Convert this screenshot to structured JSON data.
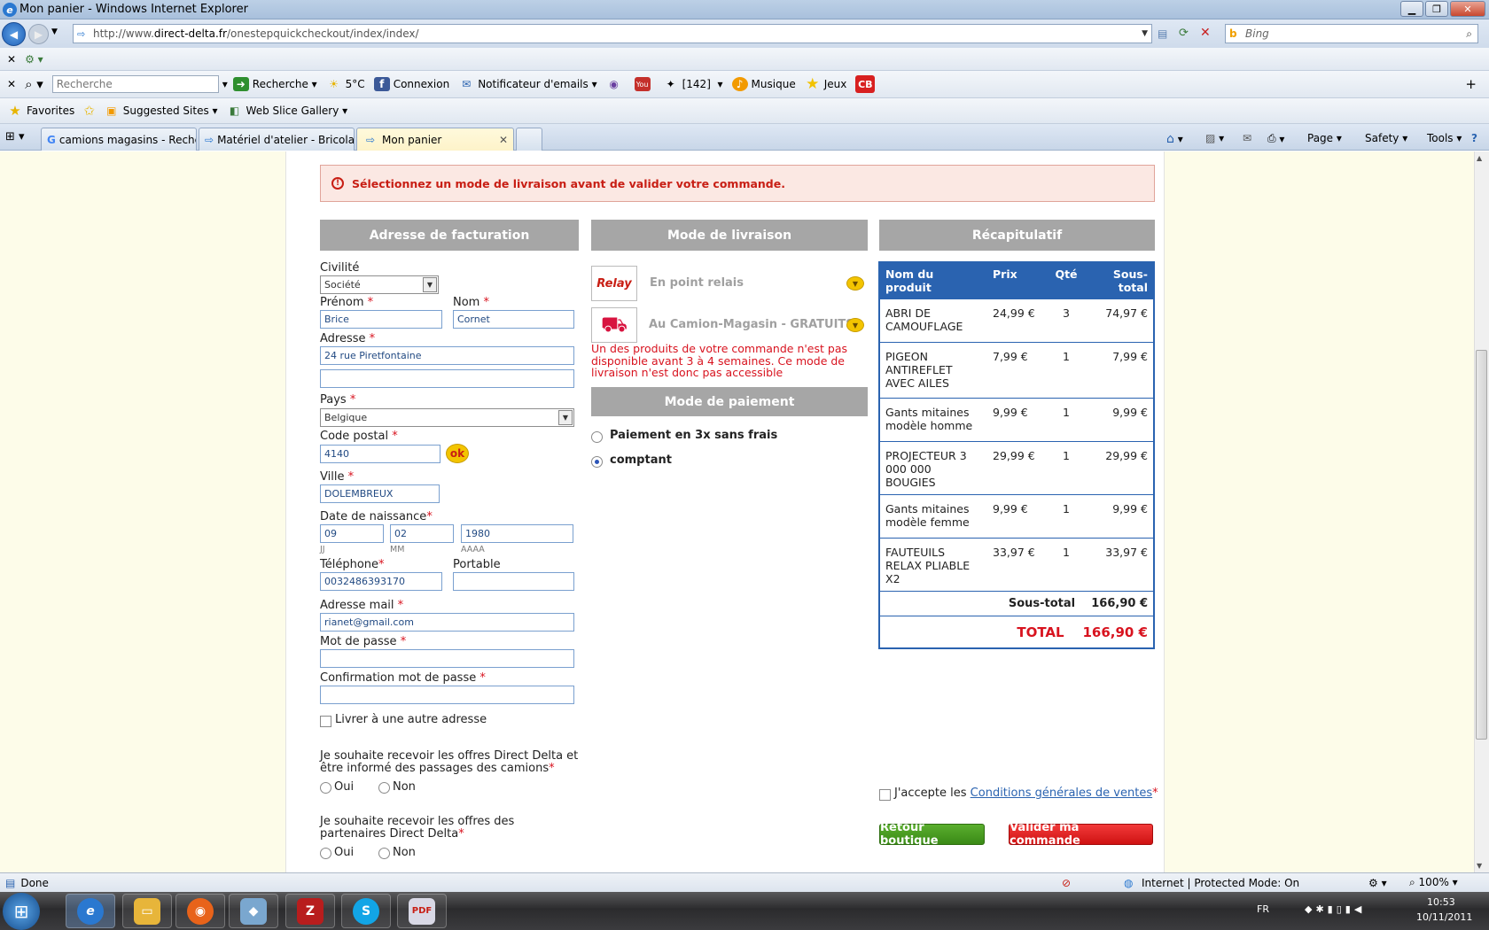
{
  "window": {
    "title": "Mon panier - Windows Internet Explorer"
  },
  "browser": {
    "url_prefix": "http://www.",
    "url_domain": "direct-delta.fr",
    "url_path": "/onestepquickcheckout/index/index/",
    "search_engine": "Bing"
  },
  "toolbar1": {
    "search_placeholder": "Recherche",
    "search_label": "Recherche",
    "weather": "5°C",
    "connexion": "Connexion",
    "mail_notifier": "Notificateur d'emails",
    "count": "[142]",
    "music": "Musique",
    "games": "Jeux",
    "cb": "CB"
  },
  "favbar": {
    "favorites": "Favorites",
    "suggested": "Suggested Sites",
    "webslice": "Web Slice Gallery"
  },
  "tabs": [
    {
      "label": "camions magasins - Reche..."
    },
    {
      "label": "Matériel d'atelier - Bricolage"
    },
    {
      "label": "Mon panier"
    }
  ],
  "commands": {
    "page": "Page",
    "safety": "Safety",
    "tools": "Tools"
  },
  "alert": "Sélectionnez un mode de livraison avant de valider votre commande.",
  "billing": {
    "header": "Adresse de facturation",
    "civilite_label": "Civilité",
    "civilite_value": "Société",
    "prenom_label": "Prénom",
    "prenom_value": "Brice",
    "nom_label": "Nom",
    "nom_value": "Cornet",
    "adresse_label": "Adresse",
    "adresse_value": "24 rue Piretfontaine",
    "pays_label": "Pays",
    "pays_value": "Belgique",
    "cp_label": "Code postal",
    "cp_value": "4140",
    "ok": "ok",
    "ville_label": "Ville",
    "ville_value": "DOLEMBREUX",
    "dob_label": "Date de naissance",
    "dob_day": "09",
    "dob_month": "02",
    "dob_year": "1980",
    "jj": "JJ",
    "mm": "MM",
    "aaaa": "AAAA",
    "tel_label": "Téléphone",
    "tel_value": "0032486393170",
    "portable_label": "Portable",
    "mail_label": "Adresse mail",
    "mail_value": "rianet@gmail.com",
    "pwd_label": "Mot de passe",
    "pwd_confirm_label": "Confirmation mot de passe",
    "other_address": "Livrer à une autre adresse",
    "offers_dd": "Je souhaite recevoir les offres Direct Delta et être informé des passages des camions",
    "offers_partners": "Je souhaite recevoir les offres des partenaires Direct Delta",
    "oui": "Oui",
    "non": "Non",
    "star": "*"
  },
  "shipping": {
    "header": "Mode de livraison",
    "relay": "En point relais",
    "relay_logo": "Relay",
    "truck": "Au Camion-Magasin - GRATUITS",
    "warning": "Un des produits de votre commande n'est pas disponible avant 3 à 4 semaines. Ce mode de livraison n'est donc pas accessible"
  },
  "payment": {
    "header": "Mode de paiement",
    "opt1": "Paiement en 3x sans frais",
    "opt2": "comptant"
  },
  "recap": {
    "header": "Récapitulatif",
    "col_name": "Nom du produit",
    "col_price": "Prix",
    "col_qty": "Qté",
    "col_sub": "Sous-total",
    "items": [
      {
        "name": "ABRI DE CAMOUFLAGE",
        "price": "24,99 €",
        "qty": "3",
        "sub": "74,97 €"
      },
      {
        "name": "PIGEON ANTIREFLET AVEC AILES",
        "price": "7,99 €",
        "qty": "1",
        "sub": "7,99 €"
      },
      {
        "name": "Gants mitaines modèle homme",
        "price": "9,99 €",
        "qty": "1",
        "sub": "9,99 €"
      },
      {
        "name": "PROJECTEUR 3 000 000 BOUGIES",
        "price": "29,99 €",
        "qty": "1",
        "sub": "29,99 €"
      },
      {
        "name": "Gants mitaines modèle femme",
        "price": "9,99 €",
        "qty": "1",
        "sub": "9,99 €"
      },
      {
        "name": "FAUTEUILS RELAX PLIABLE X2",
        "price": "33,97 €",
        "qty": "1",
        "sub": "33,97 €"
      }
    ],
    "subtotal_label": "Sous-total",
    "subtotal_value": "166,90 €",
    "total_label": "TOTAL",
    "total_value": "166,90 €",
    "accept_prefix": "J'accepte les",
    "accept_link": "Conditions générales de ventes",
    "back_btn": "Retour boutique",
    "submit_btn": "Valider ma commande"
  },
  "statusbar": {
    "done": "Done",
    "zone": "Internet | Protected Mode: On",
    "zoom": "100%"
  },
  "taskbar": {
    "lang": "FR",
    "time": "10:53",
    "date": "10/11/2011"
  },
  "colors": {
    "accent_blue": "#2a63b0",
    "alert_red": "#c81e14",
    "green_btn": "#3f8e1d",
    "red_btn": "#d8131f",
    "header_gray": "#a6a6a6"
  }
}
